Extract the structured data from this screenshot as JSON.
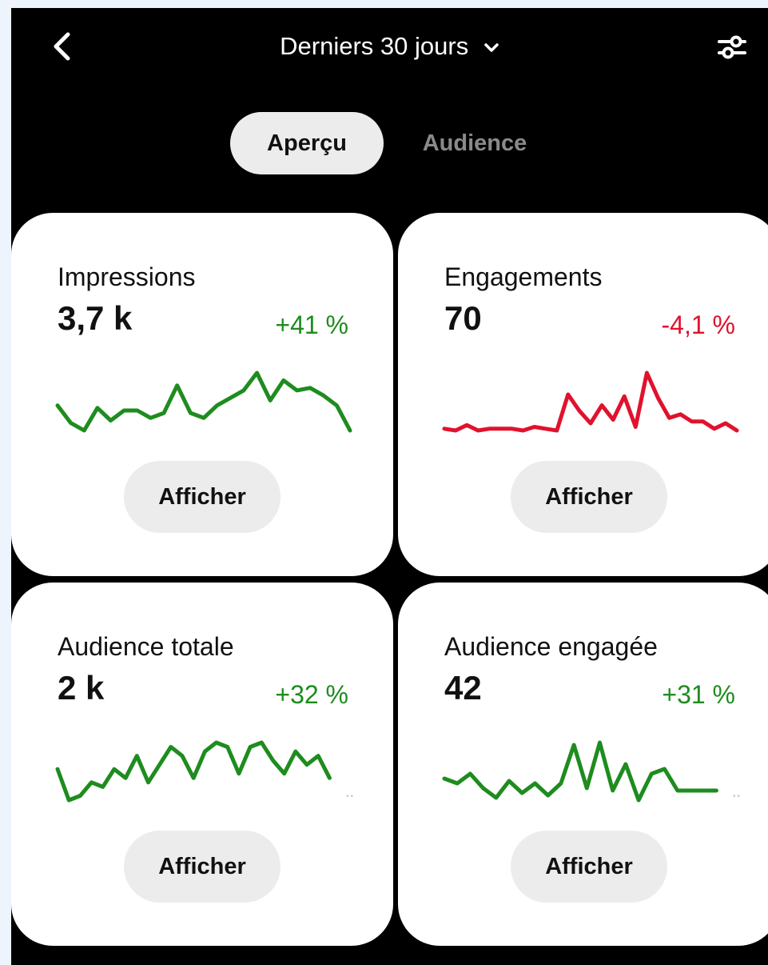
{
  "header": {
    "range_label": "Derniers 30 jours",
    "back_icon": "chevron-left-icon",
    "dropdown_icon": "chevron-down-icon",
    "filter_icon": "sliders-icon"
  },
  "tabs": [
    {
      "label": "Aperçu",
      "active": true
    },
    {
      "label": "Audience",
      "active": false
    }
  ],
  "colors": {
    "positive": "#1e8c1e",
    "negative": "#e0122d",
    "background": "#000000",
    "card": "#ffffff",
    "button": "#ececec"
  },
  "cards": [
    {
      "title": "Impressions",
      "value": "3,7 k",
      "delta": "+41 %",
      "trend": "positive",
      "button_label": "Afficher",
      "sparkline": [
        40,
        33,
        30,
        39,
        34,
        38,
        38,
        35,
        37,
        48,
        37,
        35,
        40,
        43,
        46,
        53,
        42,
        50,
        46,
        47,
        44,
        40,
        30
      ]
    },
    {
      "title": "Engagements",
      "value": "70",
      "delta": "-4,1 %",
      "trend": "negative",
      "button_label": "Afficher",
      "sparkline": [
        12,
        11,
        14,
        11,
        12,
        12,
        12,
        11,
        13,
        12,
        11,
        31,
        22,
        15,
        25,
        17,
        30,
        13,
        43,
        29,
        18,
        20,
        16,
        16,
        12,
        15,
        11
      ]
    },
    {
      "title": "Audience totale",
      "value": "2 k",
      "delta": "+32 %",
      "trend": "positive",
      "button_label": "Afficher",
      "sparkline": [
        38,
        31,
        32,
        35,
        34,
        38,
        36,
        41,
        35,
        39,
        43,
        41,
        36,
        42,
        44,
        43,
        37,
        43,
        44,
        40,
        37,
        42,
        39,
        41,
        36
      ],
      "has_more_indicator": true
    },
    {
      "title": "Audience engagée",
      "value": "42",
      "delta": "+31 %",
      "trend": "positive",
      "button_label": "Afficher",
      "sparkline": [
        20,
        18,
        22,
        16,
        12,
        19,
        14,
        18,
        13,
        18,
        34,
        16,
        35,
        15,
        26,
        11,
        22,
        24,
        15,
        15,
        15,
        15
      ],
      "has_more_indicator": true
    }
  ],
  "more_indicator": "••"
}
